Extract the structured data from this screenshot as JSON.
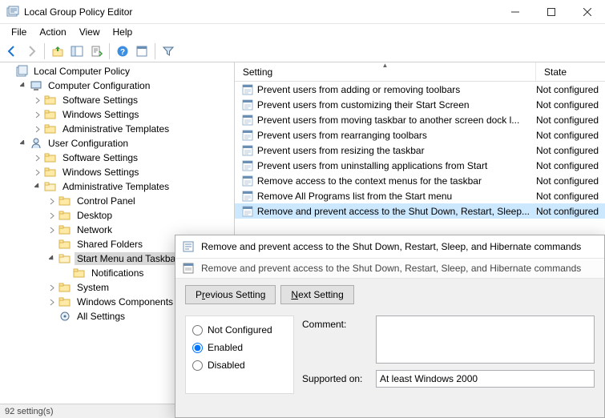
{
  "window": {
    "title": "Local Group Policy Editor"
  },
  "menubar": [
    "File",
    "Action",
    "View",
    "Help"
  ],
  "toolbar_icons": [
    "back",
    "forward",
    "up-level",
    "show-hide-tree",
    "export-list",
    "refresh",
    "help",
    "properties",
    "filter"
  ],
  "tree_root": "Local Computer Policy",
  "tree": {
    "cc": "Computer Configuration",
    "cc_children": [
      "Software Settings",
      "Windows Settings",
      "Administrative Templates"
    ],
    "uc": "User Configuration",
    "uc_children": [
      "Software Settings",
      "Windows Settings"
    ],
    "uc_admin": "Administrative Templates",
    "uc_admin_children": [
      "Control Panel",
      "Desktop",
      "Network",
      "Shared Folders"
    ],
    "uc_start": "Start Menu and Taskbar",
    "uc_start_children": [
      "Notifications"
    ],
    "uc_admin_children2": [
      "System",
      "Windows Components",
      "All Settings"
    ]
  },
  "list": {
    "headers": {
      "setting": "Setting",
      "state": "State"
    },
    "rows": [
      {
        "label": "Prevent users from adding or removing toolbars",
        "state": "Not configured"
      },
      {
        "label": "Prevent users from customizing their Start Screen",
        "state": "Not configured"
      },
      {
        "label": "Prevent users from moving taskbar to another screen dock l...",
        "state": "Not configured"
      },
      {
        "label": "Prevent users from rearranging toolbars",
        "state": "Not configured"
      },
      {
        "label": "Prevent users from resizing the taskbar",
        "state": "Not configured"
      },
      {
        "label": "Prevent users from uninstalling applications from Start",
        "state": "Not configured"
      },
      {
        "label": "Remove access to the context menus for the taskbar",
        "state": "Not configured"
      },
      {
        "label": "Remove All Programs list from the Start menu",
        "state": "Not configured"
      },
      {
        "label": "Remove and prevent access to the Shut Down, Restart, Sleep...",
        "state": "Not configured",
        "selected": true
      }
    ]
  },
  "statusbar": "92 setting(s)",
  "dialog": {
    "title": "Remove and prevent access to the Shut Down, Restart, Sleep, and Hibernate commands",
    "subtitle": "Remove and prevent access to the Shut Down, Restart, Sleep, and Hibernate commands",
    "prev_btn_pre": "P",
    "prev_btn_mne": "r",
    "prev_btn_post": "evious Setting",
    "next_btn_pre": "",
    "next_btn_mne": "N",
    "next_btn_post": "ext Setting",
    "radio_notconf": "Not Configured",
    "radio_enabled": "Enabled",
    "radio_disabled": "Disabled",
    "radio_selected": "enabled",
    "comment_label": "Comment:",
    "comment_value": "",
    "supported_label": "Supported on:",
    "supported_value": "At least Windows 2000"
  }
}
